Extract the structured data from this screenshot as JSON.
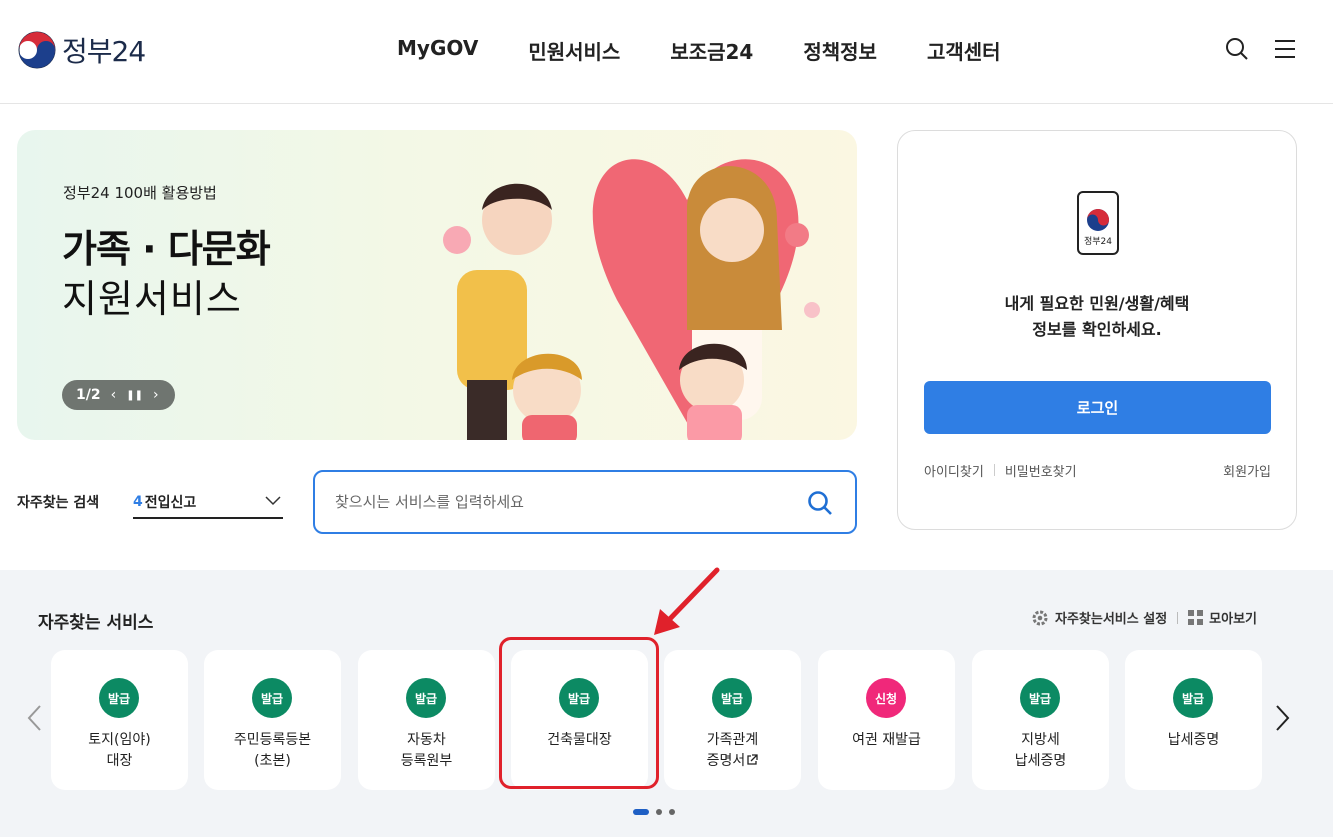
{
  "header": {
    "logo_text": "정부24",
    "nav": [
      "MyGOV",
      "민원서비스",
      "보조금24",
      "정책정보",
      "고객센터"
    ],
    "icons": [
      "search-icon",
      "menu-icon"
    ]
  },
  "banner": {
    "subtitle": "정부24 100배 활용방법",
    "title_line1": "가족 · 다문화",
    "title_line2": "지원서비스",
    "pager": "1/2"
  },
  "login_card": {
    "app_label": "정부24",
    "message_line1": "내게 필요한 민원/생활/혜택",
    "message_line2": "정보를 확인하세요.",
    "login_button": "로그인",
    "find_id": "아이디찾기",
    "find_pw": "비밀번호찾기",
    "join": "회원가입"
  },
  "search": {
    "label": "자주찾는 검색",
    "select_number": "4",
    "select_value": "전입신고",
    "placeholder": "찾으시는 서비스를 입력하세요"
  },
  "services": {
    "title": "자주찾는 서비스",
    "settings_label": "자주찾는서비스 설정",
    "view_all_label": "모아보기",
    "cards": [
      {
        "badge": "발급",
        "label": "토지(임야)\n대장"
      },
      {
        "badge": "발급",
        "label": "주민등록등본\n(초본)"
      },
      {
        "badge": "발급",
        "label": "자동차\n등록원부"
      },
      {
        "badge": "발급",
        "label": "건축물대장"
      },
      {
        "badge": "발급",
        "label": "가족관계\n증명서"
      },
      {
        "badge": "신청",
        "label": "여권 재발급"
      },
      {
        "badge": "발급",
        "label": "지방세\n납세증명"
      },
      {
        "badge": "발급",
        "label": "납세증명"
      }
    ]
  },
  "colors": {
    "primary": "#2f7ee4",
    "badge_issue": "#0c8a63",
    "badge_apply": "#f0287a",
    "highlight": "#e0212b"
  }
}
